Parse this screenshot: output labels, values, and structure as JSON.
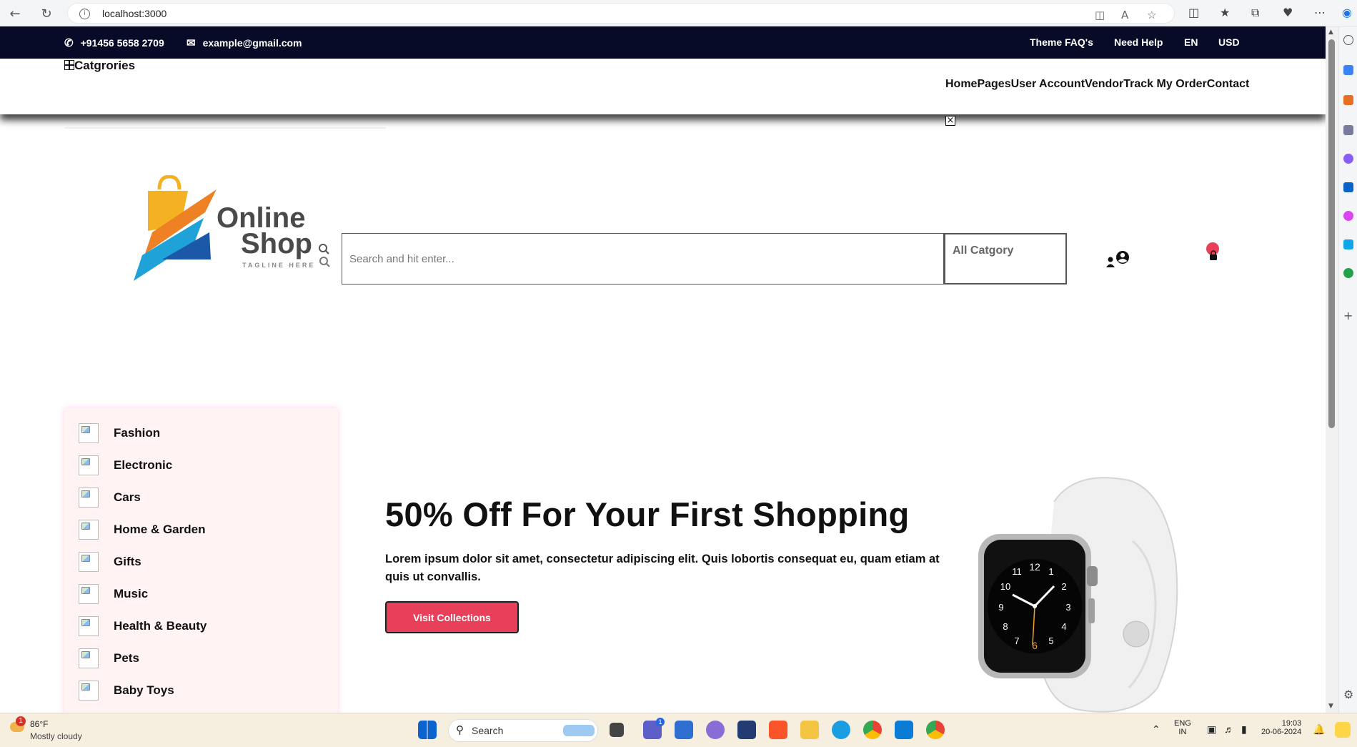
{
  "browser": {
    "url": "localhost:3000"
  },
  "topbar": {
    "phone": "+91456 5658 2709",
    "email": "example@gmail.com",
    "links": [
      "Theme FAQ's",
      "Need Help",
      "EN",
      "USD"
    ]
  },
  "navbar": {
    "categories_label": "Catgrories",
    "menu": [
      "Home",
      "Pages",
      "User Account",
      "Vendor",
      "Track My Order",
      "Contact"
    ],
    "close_symbol": "×"
  },
  "logo": {
    "line1": "Online",
    "line2": "Shop",
    "tagline": "TAGLINE HERE"
  },
  "search": {
    "placeholder": "Search and hit enter...",
    "category_selected": "All Catgory"
  },
  "categories": [
    "Fashion",
    "Electronic",
    "Cars",
    "Home & Garden",
    "Gifts",
    "Music",
    "Health & Beauty",
    "Pets",
    "Baby Toys"
  ],
  "hero": {
    "title": "50% Off For Your First Shopping",
    "description": "Lorem ipsum dolor sit amet, consectetur adipiscing elit. Quis lobortis consequat eu, quam etiam at quis ut convallis.",
    "button_label": "Visit Collections"
  },
  "colors": {
    "topbar_bg": "#070b27",
    "accent": "#e8405b",
    "panel_bg": "#fff3f4"
  },
  "taskbar": {
    "weather_badge": "1",
    "temperature": "86°F",
    "condition": "Mostly cloudy",
    "search_label": "Search",
    "teams_badge": "1",
    "language": "ENG",
    "region": "IN",
    "time": "19:03",
    "date": "20-06-2024"
  }
}
